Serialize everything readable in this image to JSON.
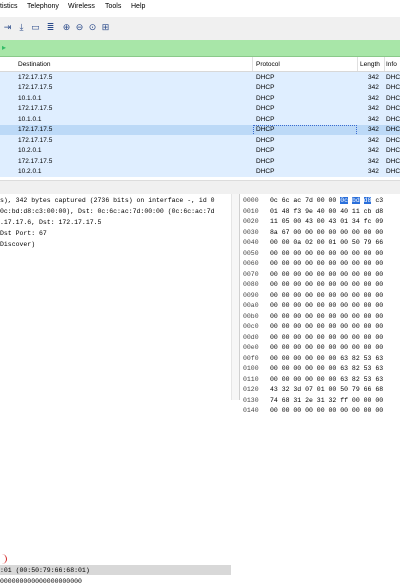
{
  "menu": [
    "tistics",
    "Telephony",
    "Wireless",
    "Tools",
    "Help"
  ],
  "toolbar": [
    "pkt-arrow-icon",
    "go-last-icon",
    "auto-scroll-icon",
    "colorize-icon",
    "zoom-in-icon",
    "zoom-out-icon",
    "zoom-normal-icon",
    "resize-columns-icon"
  ],
  "columns": {
    "destination": "Destination",
    "protocol": "Protocol",
    "length": "Length",
    "info": "Info"
  },
  "packets": [
    {
      "dest": "172.17.17.5",
      "proto": "DHCP",
      "len": "342",
      "info": "DHCF"
    },
    {
      "dest": "172.17.17.5",
      "proto": "DHCP",
      "len": "342",
      "info": "DHCF"
    },
    {
      "dest": "10.1.0.1",
      "proto": "DHCP",
      "len": "342",
      "info": "DHCF"
    },
    {
      "dest": "172.17.17.5",
      "proto": "DHCP",
      "len": "342",
      "info": "DHCF"
    },
    {
      "dest": "10.1.0.1",
      "proto": "DHCP",
      "len": "342",
      "info": "DHCF"
    },
    {
      "dest": "172.17.17.5",
      "proto": "DHCP",
      "len": "342",
      "info": "DHCF"
    },
    {
      "dest": "172.17.17.5",
      "proto": "DHCP",
      "len": "342",
      "info": "DHCF"
    },
    {
      "dest": "10.2.0.1",
      "proto": "DHCP",
      "len": "342",
      "info": "DHCF"
    },
    {
      "dest": "172.17.17.5",
      "proto": "DHCP",
      "len": "342",
      "info": "DHCF"
    },
    {
      "dest": "10.2.0.1",
      "proto": "DHCP",
      "len": "342",
      "info": "DHCF"
    }
  ],
  "selected_row": 5,
  "details": [
    "s), 342 bytes captured (2736 bits) on interface -, id 0",
    "0c:bd:d8:c3:00:00), Dst: 0c:6c:ac:7d:00:00 (0c:6c:ac:7d",
    ".17.17.6, Dst: 172.17.17.5",
    " Dst Port: 67",
    "Discover)",
    ":01 (00:50:79:66:68:01)",
    "000000000000000000000"
  ],
  "hex": [
    {
      "off": "0000",
      "bytes": "0c 6c ac 7d 00 00 0c bd d8 c3"
    },
    {
      "off": "0010",
      "bytes": "01 48 f3 9e 40 00 40 11 cb d8"
    },
    {
      "off": "0020",
      "bytes": "11 05 00 43 00 43 01 34 fc 09"
    },
    {
      "off": "0030",
      "bytes": "8a 67 00 00 00 00 00 00 00 00"
    },
    {
      "off": "0040",
      "bytes": "00 00 0a 02 00 01 00 50 79 66"
    },
    {
      "off": "0050",
      "bytes": "00 00 00 00 00 00 00 00 00 00"
    },
    {
      "off": "0060",
      "bytes": "00 00 00 00 00 00 00 00 00 00"
    },
    {
      "off": "0070",
      "bytes": "00 00 00 00 00 00 00 00 00 00"
    },
    {
      "off": "0080",
      "bytes": "00 00 00 00 00 00 00 00 00 00"
    },
    {
      "off": "0090",
      "bytes": "00 00 00 00 00 00 00 00 00 00"
    },
    {
      "off": "00a0",
      "bytes": "00 00 00 00 00 00 00 00 00 00"
    },
    {
      "off": "00b0",
      "bytes": "00 00 00 00 00 00 00 00 00 00"
    },
    {
      "off": "00c0",
      "bytes": "00 00 00 00 00 00 00 00 00 00"
    },
    {
      "off": "00d0",
      "bytes": "00 00 00 00 00 00 00 00 00 00"
    },
    {
      "off": "00e0",
      "bytes": "00 00 00 00 00 00 00 00 00 00"
    },
    {
      "off": "00f0",
      "bytes": "00 00 00 00 00 00 63 82 53 63"
    },
    {
      "off": "0100",
      "bytes": "00 00 00 00 00 00 63 82 53 63"
    },
    {
      "off": "0110",
      "bytes": "00 00 00 00 00 00 63 82 53 63"
    },
    {
      "off": "0120",
      "bytes": "43 32 3d 07 01 00 50 79 66 68"
    },
    {
      "off": "0130",
      "bytes": "74 68 31 2e 31 32 ff 00 00 00"
    },
    {
      "off": "0140",
      "bytes": "00 00 00 00 00 00 00 00 00 00"
    }
  ],
  "colors": {
    "filter_bg": "#a8e6a8",
    "row_bg": "#dfeeff",
    "selected_row_bg": "#bcd9f7",
    "hex_highlight": "#2a6fdb"
  }
}
